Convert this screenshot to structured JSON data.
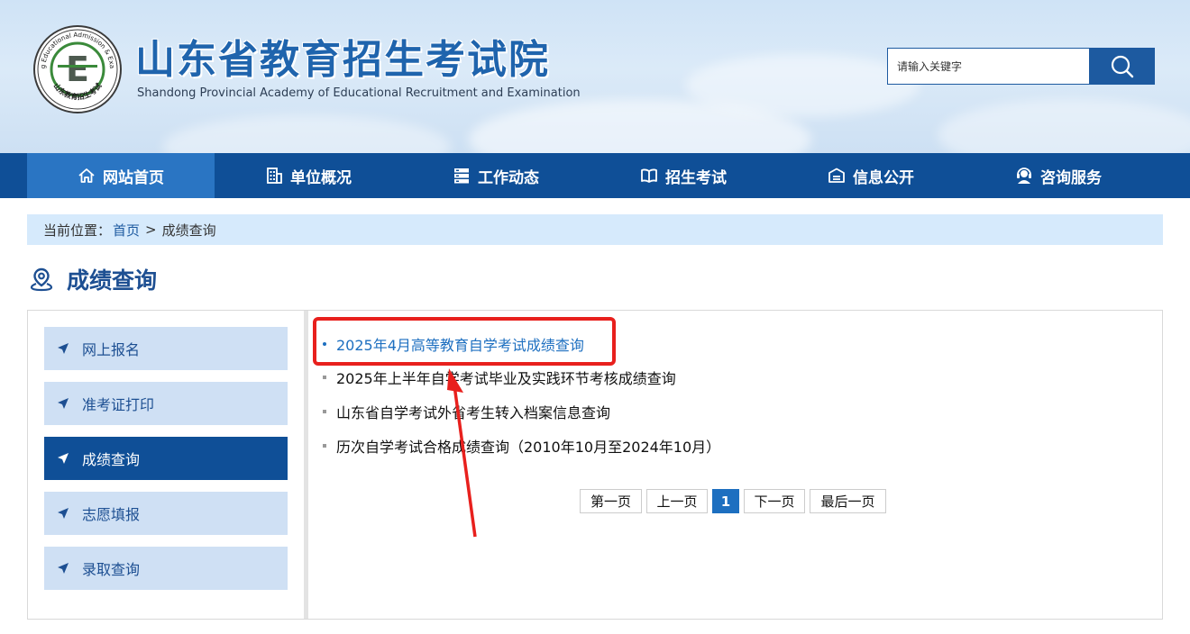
{
  "header": {
    "logo_title": "山东省教育招生考试院",
    "logo_subtitle": "Shandong Provincial Academy of Educational Recruitment and Examination",
    "emblem_ring_text": "Shandong Educational Admission & Examination",
    "emblem_bottom_text": "山东教育招生考试",
    "emblem_letter": "E",
    "search": {
      "placeholder": "请输入关键字",
      "icon": "search-icon"
    }
  },
  "nav": {
    "items": [
      {
        "label": "网站首页",
        "icon": "home-icon",
        "active": true
      },
      {
        "label": "单位概况",
        "icon": "building-icon",
        "active": false
      },
      {
        "label": "工作动态",
        "icon": "server-icon",
        "active": false
      },
      {
        "label": "招生考试",
        "icon": "book-icon",
        "active": false
      },
      {
        "label": "信息公开",
        "icon": "info-box-icon",
        "active": false
      },
      {
        "label": "咨询服务",
        "icon": "headset-icon",
        "active": false
      }
    ]
  },
  "breadcrumb": {
    "prefix": "当前位置：",
    "home": "首页",
    "separator": ">",
    "current": "成绩查询"
  },
  "page": {
    "title": "成绩查询",
    "title_icon": "location-pin-icon"
  },
  "sidebar": {
    "items": [
      {
        "label": "网上报名",
        "active": false
      },
      {
        "label": "准考证打印",
        "active": false
      },
      {
        "label": "成绩查询",
        "active": true
      },
      {
        "label": "志愿填报",
        "active": false
      },
      {
        "label": "录取查询",
        "active": false
      }
    ]
  },
  "list": {
    "items": [
      "2025年4月高等教育自学考试成绩查询",
      "2025年上半年自学考试毕业及实践环节考核成绩查询",
      "山东省自学考试外省考生转入档案信息查询",
      "历次自学考试合格成绩查询（2010年10月至2024年10月）"
    ]
  },
  "pagination": {
    "first": "第一页",
    "prev": "上一页",
    "current": "1",
    "next": "下一页",
    "last": "最后一页"
  },
  "colors": {
    "brand_blue": "#0f4f97",
    "nav_active": "#2a75c3",
    "link_blue": "#1d6fc0",
    "highlight_red": "#e8201d"
  }
}
